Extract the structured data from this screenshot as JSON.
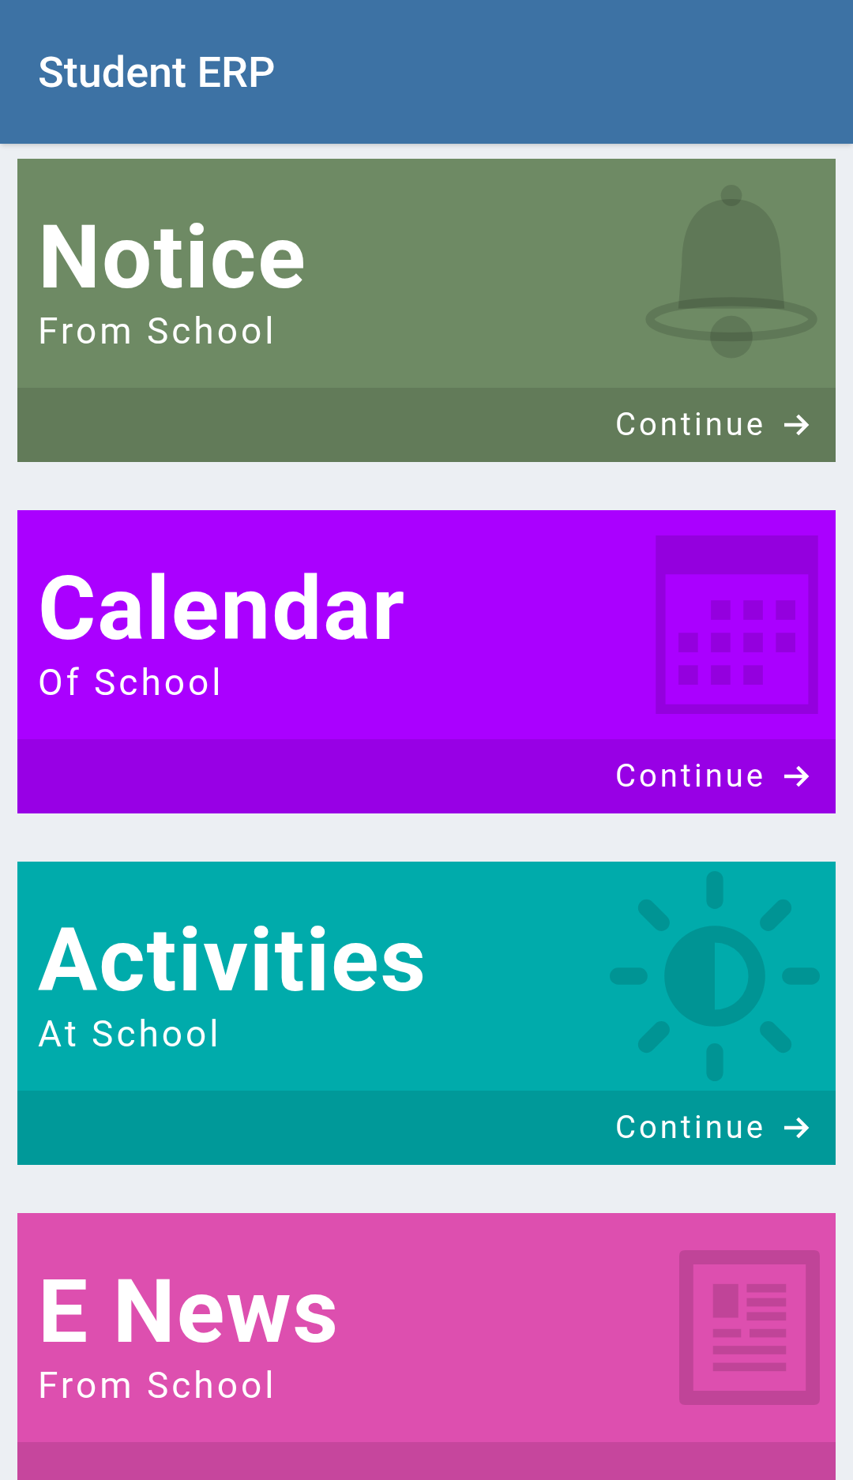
{
  "app_bar": {
    "title": "Student ERP"
  },
  "cards": [
    {
      "title": "Notice",
      "subtitle": "From School",
      "action": "Continue",
      "color": "#6e8a64"
    },
    {
      "title": "Calendar",
      "subtitle": "Of School",
      "action": "Continue",
      "color": "#aa00ff"
    },
    {
      "title": "Activities",
      "subtitle": "At School",
      "action": "Continue",
      "color": "#00abab"
    },
    {
      "title": "E News",
      "subtitle": "From School",
      "color": "#dd4faf"
    }
  ]
}
